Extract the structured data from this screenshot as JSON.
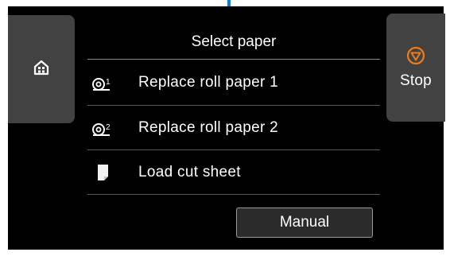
{
  "header": {
    "title": "Select paper"
  },
  "buttons": {
    "home_icon": "home-icon",
    "stop_label": "Stop",
    "stop_icon": "stop-icon",
    "manual_label": "Manual"
  },
  "options": [
    {
      "label": "Replace roll paper 1",
      "icon": "roll-paper-1-icon"
    },
    {
      "label": "Replace roll paper 2",
      "icon": "roll-paper-2-icon"
    },
    {
      "label": "Load cut sheet",
      "icon": "cut-sheet-icon"
    }
  ],
  "colors": {
    "screen_bg": "#000000",
    "side_button_bg": "#424242",
    "stop_accent": "#f07c1a",
    "indicator": "#0a7fd9"
  }
}
